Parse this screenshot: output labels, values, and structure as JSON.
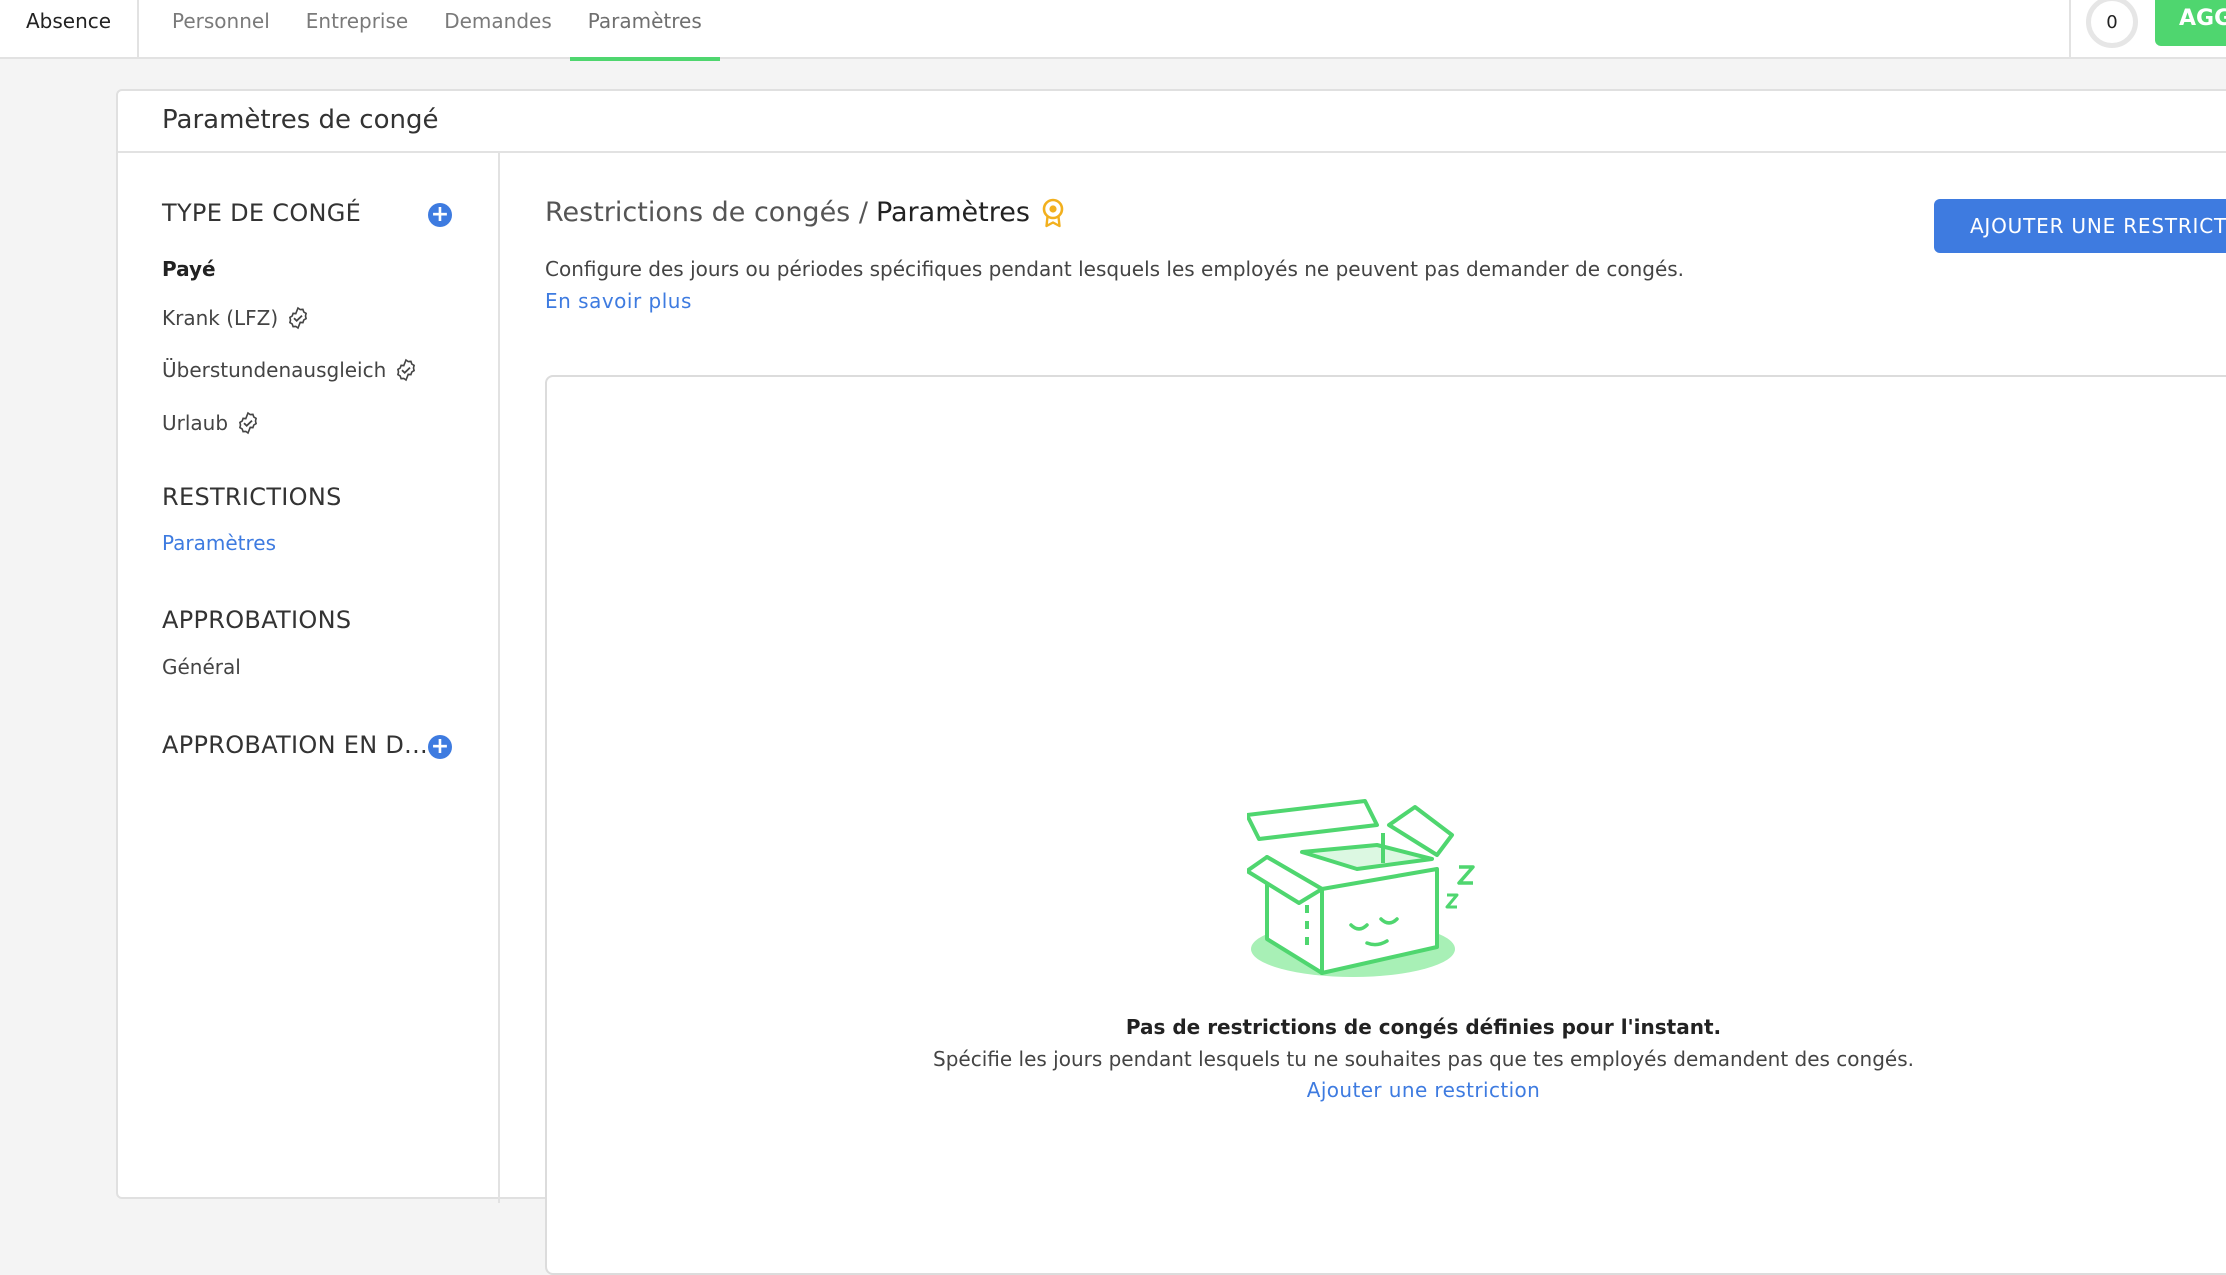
{
  "topbar": {
    "app_name": "Absence",
    "tabs": [
      {
        "label": "Personnel"
      },
      {
        "label": "Entreprise"
      },
      {
        "label": "Demandes"
      },
      {
        "label": "Paramètres",
        "active": true
      }
    ],
    "counter": "0",
    "green_button_label": "AGG"
  },
  "card": {
    "title": "Paramètres de congé"
  },
  "sidebar": {
    "leave_type_title": "TYPE DE CONGÉ",
    "leave_types": [
      {
        "label": "Payé",
        "verified": false
      },
      {
        "label": "Krank (LFZ)",
        "verified": true
      },
      {
        "label": "Überstundenausgleich",
        "verified": true
      },
      {
        "label": "Urlaub",
        "verified": true
      }
    ],
    "restrictions_title": "RESTRICTIONS",
    "restrictions_item": "Paramètres",
    "approvals_title": "APPROBATIONS",
    "approvals_item": "Général",
    "delegated_title": "APPROBATION EN D..."
  },
  "main": {
    "breadcrumb_parent": "Restrictions de congés /",
    "breadcrumb_current": "Paramètres",
    "description": "Configure des jours ou périodes spécifiques pendant lesquels les employés ne peuvent pas demander de congés.",
    "learn_more": "En savoir plus",
    "add_button": "AJOUTER UNE RESTRICTION",
    "empty_title": "Pas de restrictions de congés définies pour l'instant.",
    "empty_subtitle": "Spécifie les jours pendant lesquels tu ne souhaites pas que tes employés demandent des congés.",
    "empty_link": "Ajouter une restriction"
  },
  "colors": {
    "accent_blue": "#3e7be0",
    "accent_green": "#4fd66f",
    "award_yellow": "#f2b01e"
  }
}
